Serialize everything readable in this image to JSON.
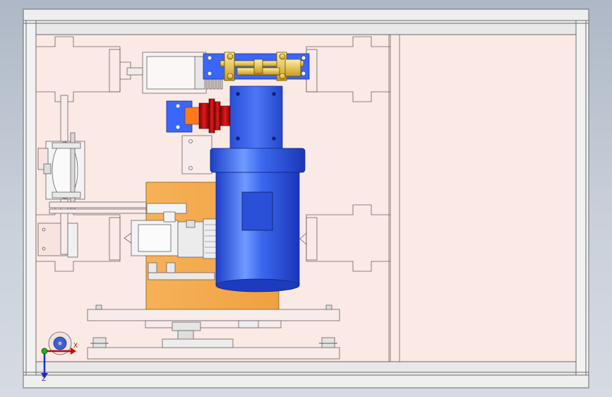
{
  "view": {
    "background_top": "#aeb8c6",
    "background_bottom": "#d6dbe3"
  },
  "colors": {
    "panel": "#fbe9e6",
    "frame": "#e6e6e6",
    "line": "#6b6060",
    "motor_blue": "#2f5fe8",
    "motor_dark": "#1a3fc0",
    "bracket_blue": "#3a66ff",
    "orange_block": "#f3a94a",
    "brass": "#e8c24a",
    "flange_red": "#d31818",
    "shaft_orange": "#ff7a1a"
  },
  "triad": {
    "x_label": "X",
    "z_label": "Z",
    "icon": "coordinate-triad-icon"
  }
}
